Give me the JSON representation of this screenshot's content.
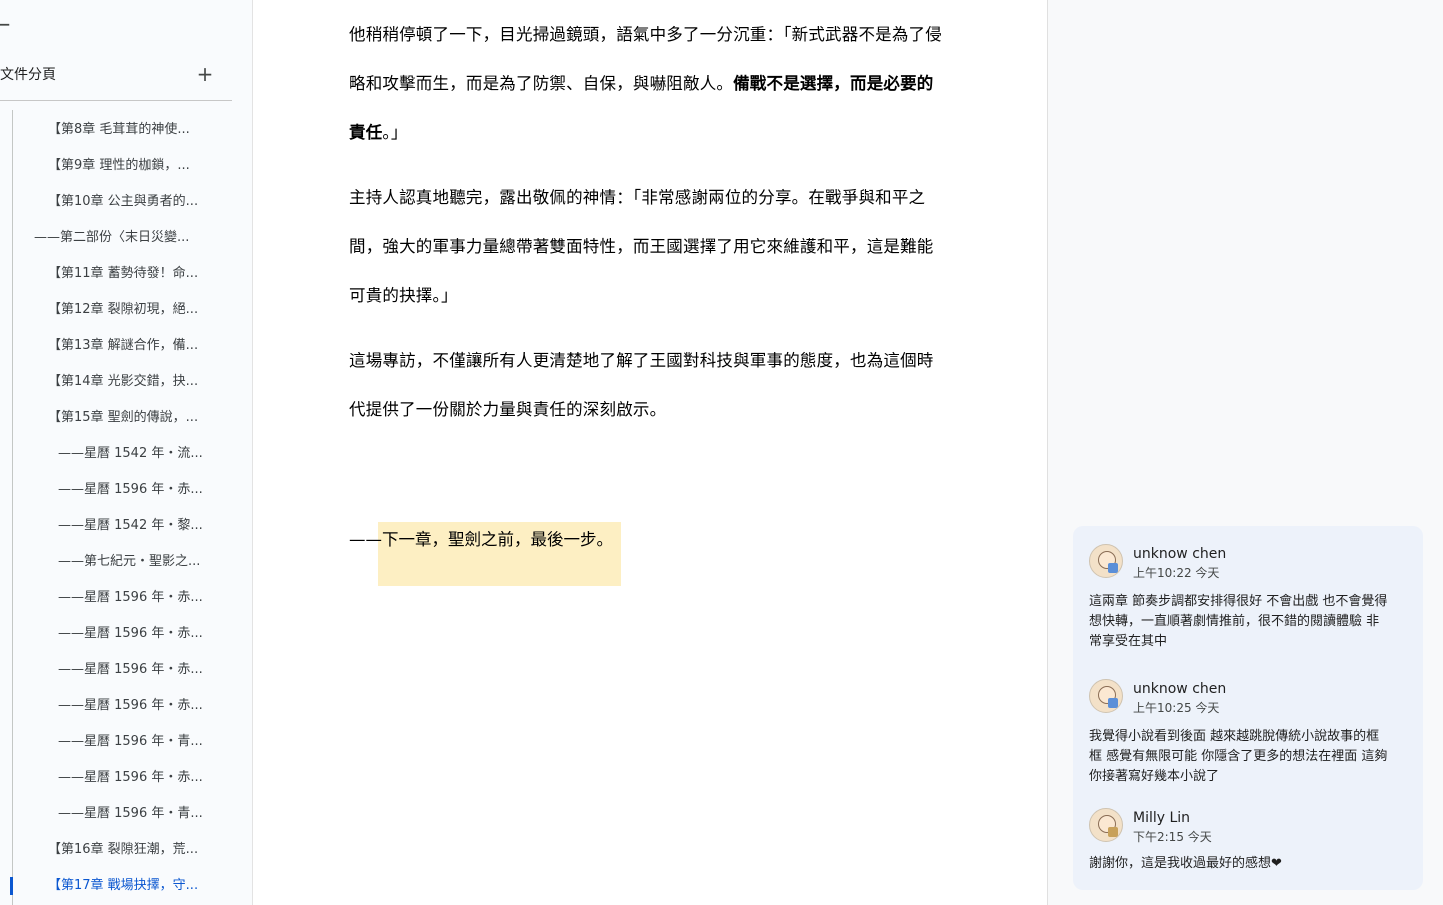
{
  "sidebar": {
    "back_icon": "←",
    "title": "文件分頁",
    "add_icon": "+",
    "items": [
      {
        "label": "【第8章 毛茸茸的神使...",
        "level": 1
      },
      {
        "label": "【第9章 理性的枷鎖，...",
        "level": 1
      },
      {
        "label": "【第10章 公主與勇者的...",
        "level": 1
      },
      {
        "label": "——第二部份〈末日災變...",
        "level": 0
      },
      {
        "label": "【第11章 蓄勢待發！命...",
        "level": 1
      },
      {
        "label": "【第12章 裂隙初現，絕...",
        "level": 1
      },
      {
        "label": "【第13章 解謎合作，備...",
        "level": 1
      },
      {
        "label": "【第14章 光影交錯，抉...",
        "level": 1
      },
      {
        "label": "【第15章 聖劍的傳說，...",
        "level": 1
      },
      {
        "label": "——星曆 1542 年・流...",
        "level": 2
      },
      {
        "label": "——星曆 1596 年・赤...",
        "level": 2
      },
      {
        "label": "——星曆 1542 年・黎...",
        "level": 2
      },
      {
        "label": "——第七紀元・聖影之...",
        "level": 2
      },
      {
        "label": "——星曆 1596 年・赤...",
        "level": 2
      },
      {
        "label": "——星曆 1596 年・赤...",
        "level": 2
      },
      {
        "label": "——星曆 1596 年・赤...",
        "level": 2
      },
      {
        "label": "——星曆 1596 年・赤...",
        "level": 2
      },
      {
        "label": "——星曆 1596 年・青...",
        "level": 2
      },
      {
        "label": "——星曆 1596 年・赤...",
        "level": 2
      },
      {
        "label": "——星曆 1596 年・青...",
        "level": 2
      },
      {
        "label": "【第16章 裂隙狂潮，荒...",
        "level": 1
      },
      {
        "label": "【第17章 戰場抉擇，守...",
        "level": 1,
        "active": true
      }
    ]
  },
  "document": {
    "p1_normal": "他稍稍停頓了一下，目光掃過鏡頭，語氣中多了一分沉重：「新式武器不是為了侵略和攻擊而生，而是為了防禦、自保，與嚇阻敵人。",
    "p1_bold": "備戰不是選擇，而是必要的責任",
    "p1_end": "。」",
    "p2": "主持人認真地聽完，露出敬佩的神情：「非常感謝兩位的分享。在戰爭與和平之間，強大的軍事力量總帶著雙面特性，而王國選擇了用它來維護和平，這是難能可貴的抉擇。」",
    "p3": "這場專訪，不僅讓所有人更清楚地了解了王國對科技與軍事的態度，也為這個時代提供了一份關於力量與責任的深刻啟示。",
    "closing_dash": "——",
    "closing_text": "下一章，聖劍之前，最後一步。",
    "highlight_color": "#fdefc3"
  },
  "comments": [
    {
      "author": "unknow chen",
      "time": "上午10:22 今天",
      "body": "這兩章 節奏步調都安排得很好 不會出戲 也不會覺得想快轉，一直順著劇情推前，很不錯的閱讀體驗  非常享受在其中"
    },
    {
      "author": "unknow chen",
      "time": "上午10:25 今天",
      "body": "我覺得小說看到後面 越來越跳脫傳統小說故事的框框 感覺有無限可能 你隱含了更多的想法在裡面  這夠你接著寫好幾本小說了"
    },
    {
      "author": "Milly Lin",
      "time": "下午2:15 今天",
      "body": "謝謝你，這是我收過最好的感想❤"
    }
  ]
}
